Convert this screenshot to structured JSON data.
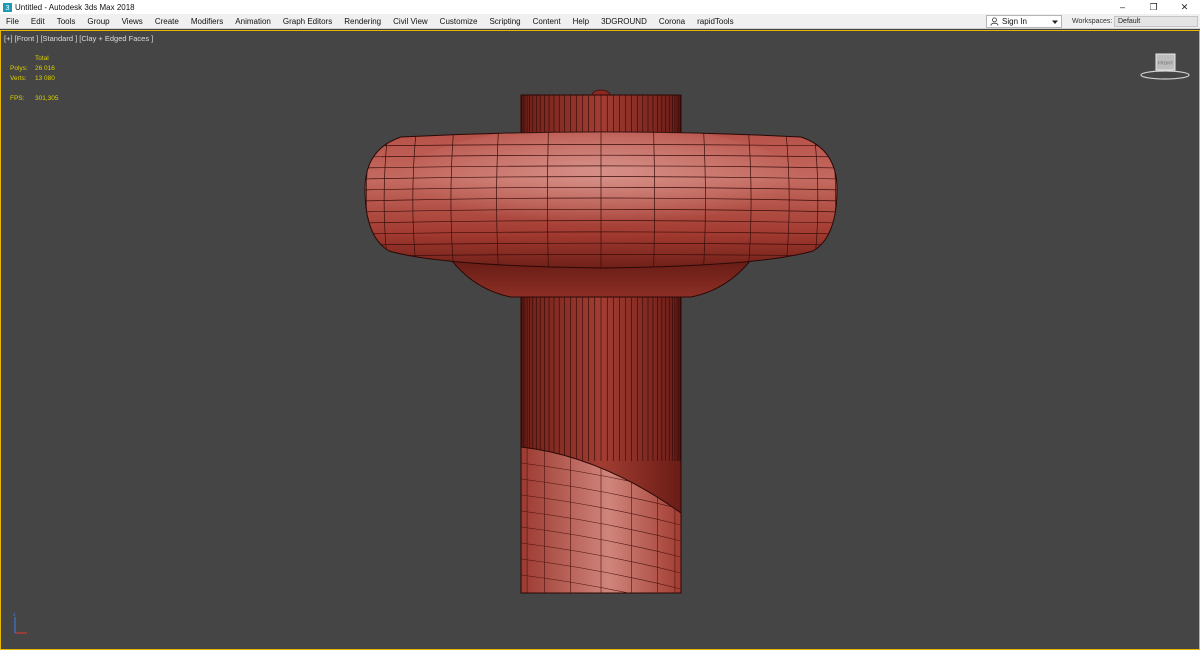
{
  "window": {
    "title": "Untitled - Autodesk 3ds Max 2018",
    "controls": {
      "minimize": "–",
      "maximize": "❐",
      "close": "✕"
    }
  },
  "menu": {
    "items": [
      "File",
      "Edit",
      "Tools",
      "Group",
      "Views",
      "Create",
      "Modifiers",
      "Animation",
      "Graph Editors",
      "Rendering",
      "Civil View",
      "Customize",
      "Scripting",
      "Content",
      "Help",
      "3DGROUND",
      "Corona",
      "rapidTools"
    ],
    "sign_in": "Sign In",
    "workspaces_label": "Workspaces:",
    "workspaces_value": "Default"
  },
  "viewport": {
    "label": "[+] [Front ] [Standard ] [Clay + Edged Faces ]",
    "stats": {
      "header": "Total",
      "polys_label": "Polys:",
      "polys_value": "26 016",
      "verts_label": "Verts:",
      "verts_value": "13 080",
      "fps_label": "FPS:",
      "fps_value": "301,305"
    },
    "model_color": "#a8382e",
    "viewcube_face": "FRONT",
    "axis_icon": "axis-tripod-icon"
  },
  "colors": {
    "viewport_bg": "#454545",
    "active_border": "#e6b700",
    "stats_text": "#e0d000"
  }
}
